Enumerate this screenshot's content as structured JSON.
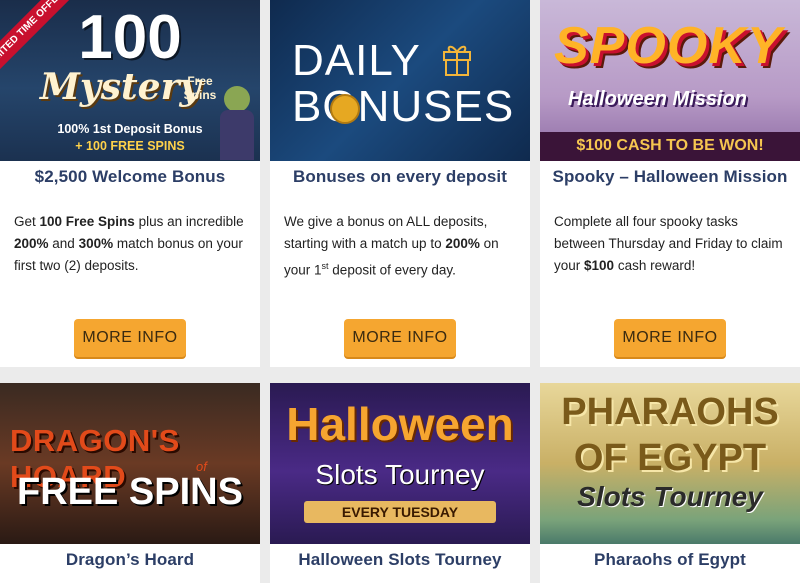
{
  "promos": [
    {
      "title": "$2,500 Welcome Bonus",
      "banner": {
        "ribbon": "LIMITED TIME OFFER!",
        "big": "100",
        "line1": "Mystery",
        "line1b": "Free Spins",
        "sub1": "100% 1st Deposit Bonus",
        "sub2": "+ 100 FREE SPINS"
      },
      "desc": {
        "p1": "Get ",
        "b1": "100 Free Spins",
        "p2": " plus an incredible ",
        "b2": "200%",
        "p3": " and ",
        "b3": "300%",
        "p4": " match bonus on your first two (2) deposits."
      },
      "button": "MORE INFO"
    },
    {
      "title": "Bonuses on every deposit",
      "banner": {
        "line1": "DAILY",
        "line2": "BONUSES"
      },
      "desc": {
        "p1": "We give a bonus on ALL deposits, starting with a match up to ",
        "b1": "200%",
        "p2": " on your 1",
        "sup": "st",
        "p3": " deposit of every day."
      },
      "button": "MORE INFO"
    },
    {
      "title": "Spooky – Halloween Mission",
      "banner": {
        "line1": "SPOOKY",
        "line2": "Halloween Mission",
        "line3": "$100 CASH TO BE WON!"
      },
      "desc": {
        "p1": "Complete all four spooky tasks between Thursday and Friday to claim your ",
        "b1": "$100",
        "p2": " cash reward!"
      },
      "button": "MORE INFO"
    },
    {
      "title": "Dragon’s Hoard",
      "banner": {
        "line1": "DRAGON'S HOARD",
        "small": "of",
        "line2": "FREE SPINS"
      }
    },
    {
      "title": "Halloween Slots Tourney",
      "banner": {
        "line1": "Halloween",
        "line2": "Slots Tourney",
        "line3": "EVERY TUESDAY"
      }
    },
    {
      "title": "Pharaohs of Egypt",
      "banner": {
        "line1": "PHARAOHS",
        "line2": "OF EGYPT",
        "line3": "Slots Tourney"
      }
    }
  ],
  "colors": {
    "title": "#2c3e66",
    "button": "#f5a630",
    "background": "#ebebeb"
  }
}
